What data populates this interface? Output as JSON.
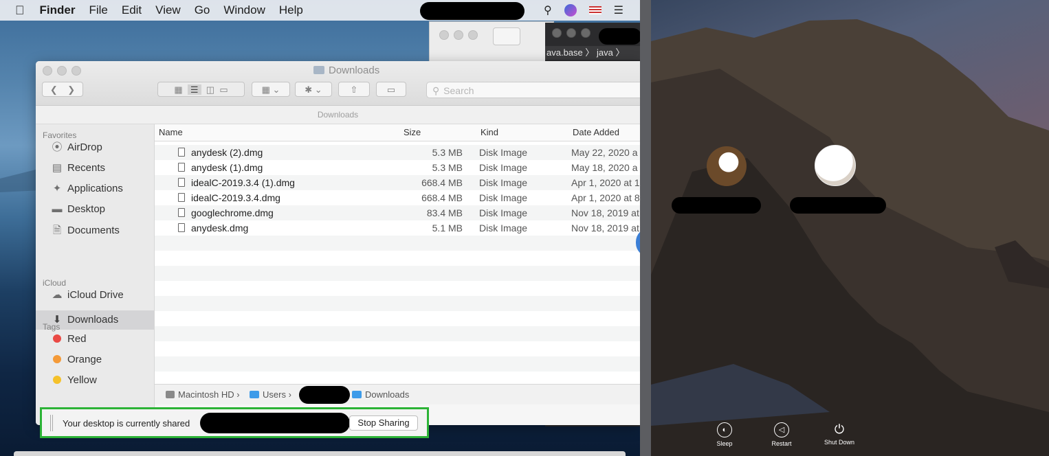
{
  "menubar": {
    "app": "Finder",
    "items": [
      "File",
      "Edit",
      "View",
      "Go",
      "Window",
      "Help"
    ],
    "icons": [
      "search-icon",
      "siri-icon",
      "us-flag-icon",
      "list-icon"
    ]
  },
  "bg_window": {
    "path": "ava.base 〉 java 〉"
  },
  "finder": {
    "title": "Downloads",
    "path_header": "Downloads",
    "search_placeholder": "Search",
    "sidebar": {
      "favorites_label": "Favorites",
      "favorites": [
        {
          "label": "AirDrop",
          "icon": "airdrop-icon"
        },
        {
          "label": "Recents",
          "icon": "recents-icon"
        },
        {
          "label": "Applications",
          "icon": "applications-icon"
        },
        {
          "label": "Desktop",
          "icon": "desktop-icon"
        },
        {
          "label": "Documents",
          "icon": "documents-icon"
        },
        {
          "label": "Downloads",
          "icon": "downloads-icon"
        }
      ],
      "icloud_label": "iCloud",
      "icloud": [
        {
          "label": "iCloud Drive",
          "icon": "cloud-icon"
        }
      ],
      "tags_label": "Tags",
      "tags": [
        {
          "label": "Red",
          "color": "#ea4a45"
        },
        {
          "label": "Orange",
          "color": "#f49a38"
        },
        {
          "label": "Yellow",
          "color": "#f5c12a"
        }
      ]
    },
    "columns": {
      "name": "Name",
      "size": "Size",
      "kind": "Kind",
      "date": "Date Added"
    },
    "files": [
      {
        "name": "anydesk (2).dmg",
        "size": "5.3 MB",
        "kind": "Disk Image",
        "date": "May 22, 2020 a"
      },
      {
        "name": "anydesk (1).dmg",
        "size": "5.3 MB",
        "kind": "Disk Image",
        "date": "May 18, 2020 a"
      },
      {
        "name": "idealC-2019.3.4 (1).dmg",
        "size": "668.4 MB",
        "kind": "Disk Image",
        "date": "Apr 1, 2020 at 1"
      },
      {
        "name": "idealC-2019.3.4.dmg",
        "size": "668.4 MB",
        "kind": "Disk Image",
        "date": "Apr 1, 2020 at 8"
      },
      {
        "name": "googlechrome.dmg",
        "size": "83.4 MB",
        "kind": "Disk Image",
        "date": "Nov 18, 2019 at"
      },
      {
        "name": "anydesk.dmg",
        "size": "5.1 MB",
        "kind": "Disk Image",
        "date": "Nov 18, 2019 at"
      }
    ],
    "statusbar": {
      "drive": "Macintosh HD",
      "users": "Users",
      "folder": "Downloads",
      "sep": "›"
    }
  },
  "share_banner": {
    "text": "Your desktop is currently shared",
    "button": "Stop Sharing"
  },
  "login": {
    "buttons": [
      {
        "label": "Sleep",
        "icon": "sleep-icon"
      },
      {
        "label": "Restart",
        "icon": "restart-icon"
      },
      {
        "label": "Shut Down",
        "icon": "power-icon"
      }
    ]
  }
}
